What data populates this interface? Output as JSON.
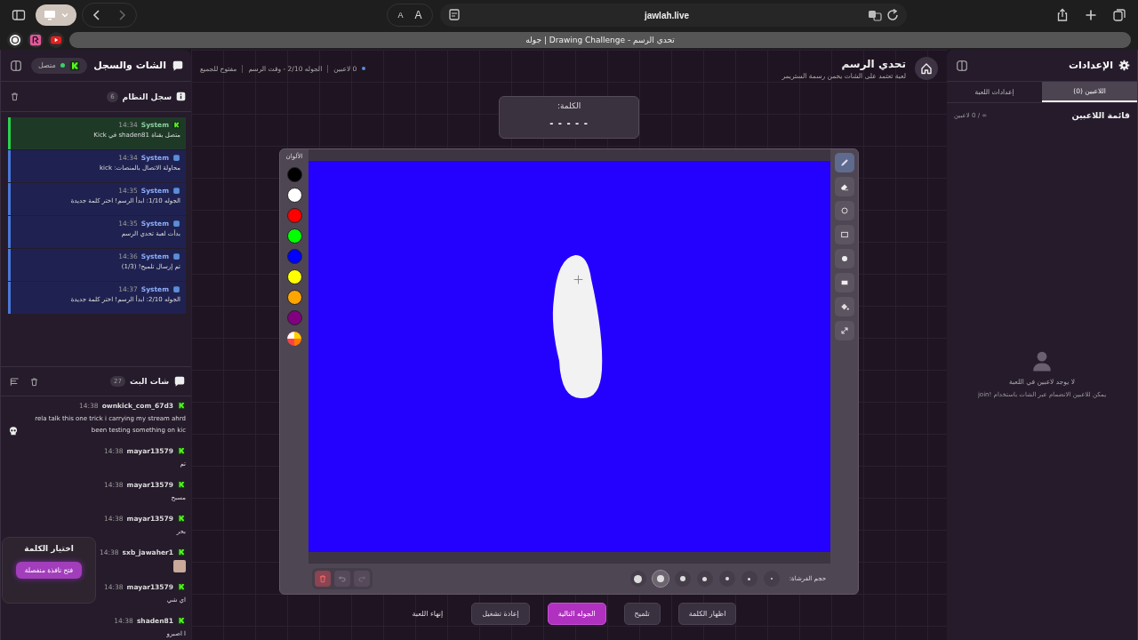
{
  "browser": {
    "address": "jawlah.live",
    "tab_title": "تحدي الرسم - Drawing Challenge | جوله",
    "text_size": {
      "smaller": "A",
      "larger": "A"
    }
  },
  "chat_panel": {
    "title": "الشات والسجل",
    "status": "متصل",
    "connected": true,
    "system_log": {
      "title": "سجل النظام",
      "count": "6",
      "entries": [
        {
          "kind": "kick",
          "sender": "System",
          "time": "14:34",
          "text": "متصل بقناة shaden81 في Kick"
        },
        {
          "kind": "system",
          "sender": "System",
          "time": "14:34",
          "text": "محاولة الاتصال بالمنصات: kick"
        },
        {
          "kind": "system",
          "sender": "System",
          "time": "14:35",
          "text": "الجوله 1/10: ابدأ الرسم! اختر كلمة جديدة"
        },
        {
          "kind": "system",
          "sender": "System",
          "time": "14:35",
          "text": "بدأت لعبة تحدي الرسم"
        },
        {
          "kind": "system",
          "sender": "System",
          "time": "14:36",
          "text": "تم إرسال تلميح! (1/3)"
        },
        {
          "kind": "system",
          "sender": "System",
          "time": "14:37",
          "text": "الجوله 2/10: ابدأ الرسم! اختر كلمة جديدة"
        }
      ]
    },
    "stream_chat": {
      "title": "شات البث",
      "count": "27",
      "messages": [
        {
          "kind": "text_skull",
          "user": "ownkick_com_67d3",
          "time": "14:38",
          "text": "rela talk this one trick i carrying my stream ahrd been testing something on kic"
        },
        {
          "kind": "text",
          "user": "mayar13579",
          "time": "14:38",
          "text": "تم"
        },
        {
          "kind": "text",
          "user": "mayar13579",
          "time": "14:38",
          "text": "مسبح"
        },
        {
          "kind": "text",
          "user": "mayar13579",
          "time": "14:38",
          "text": "بحر"
        },
        {
          "kind": "image",
          "user": "sxb_jawaher1",
          "time": "14:38"
        },
        {
          "kind": "text",
          "user": "mayar13579",
          "time": "14:38",
          "text": "اي شي"
        },
        {
          "kind": "text",
          "user": "shaden81",
          "time": "14:38",
          "text": "ا اصبرو"
        }
      ]
    },
    "word_picker": {
      "title": "اختيار الكلمة",
      "button": "فتح نافذة منفصلة"
    }
  },
  "game": {
    "title": "تحدي الرسم",
    "subtitle": "لعبة تعتمد على الشات يخمن رسمة الستريمر",
    "status": [
      "0 لاعبين",
      "الجوله 2/10 - وقت الرسم",
      "مفتوح للجميع"
    ],
    "word_label": "الكلمة:",
    "word_mask": "- - - - -",
    "colors_label": "الألوان",
    "colors": [
      {
        "color": "#000000"
      },
      {
        "color": "#ffffff"
      },
      {
        "color": "#ff0000"
      },
      {
        "color": "#00ff00"
      },
      {
        "color": "#0000ff"
      },
      {
        "color": "#ffff00"
      },
      {
        "color": "#ffa500"
      },
      {
        "color": "#800080"
      }
    ],
    "tools": [
      {
        "kind": "pen",
        "selected": true
      },
      {
        "kind": "eraser",
        "selected": false
      },
      {
        "kind": "circle",
        "selected": false
      },
      {
        "kind": "rect",
        "selected": false
      },
      {
        "kind": "dot",
        "selected": false
      },
      {
        "kind": "bar",
        "selected": false
      },
      {
        "kind": "fill",
        "selected": false
      },
      {
        "kind": "expand",
        "selected": false
      }
    ],
    "brush_label": "حجم الفرشاة:",
    "brush_sizes": [
      {
        "selected": false
      },
      {
        "selected": false
      },
      {
        "selected": false
      },
      {
        "selected": false
      },
      {
        "selected": false
      },
      {
        "selected": true
      },
      {
        "selected": false
      }
    ],
    "actions": [
      {
        "label": "اظهار الكلمة",
        "primary": false
      },
      {
        "label": "تلميح",
        "primary": false
      },
      {
        "label": "الجوله التالية",
        "primary": true
      },
      {
        "label": "إعادة تشغيل",
        "primary": false
      },
      {
        "label": "إنهاء اللعبة",
        "primary": false
      }
    ]
  },
  "settings_panel": {
    "title": "الإعدادات",
    "tabs": [
      {
        "label": "اللاعبين (0)",
        "selected": true
      },
      {
        "label": "إعدادات اللعبة",
        "selected": false
      }
    ],
    "list_title": "قائمة اللاعبين",
    "list_count": "∞ / 0 لاعبين",
    "empty_title": "لا يوجد لاعبين في اللعبة",
    "empty_hint": "يمكن للاعبين الانضمام عبر الشات باستخدام !join"
  }
}
